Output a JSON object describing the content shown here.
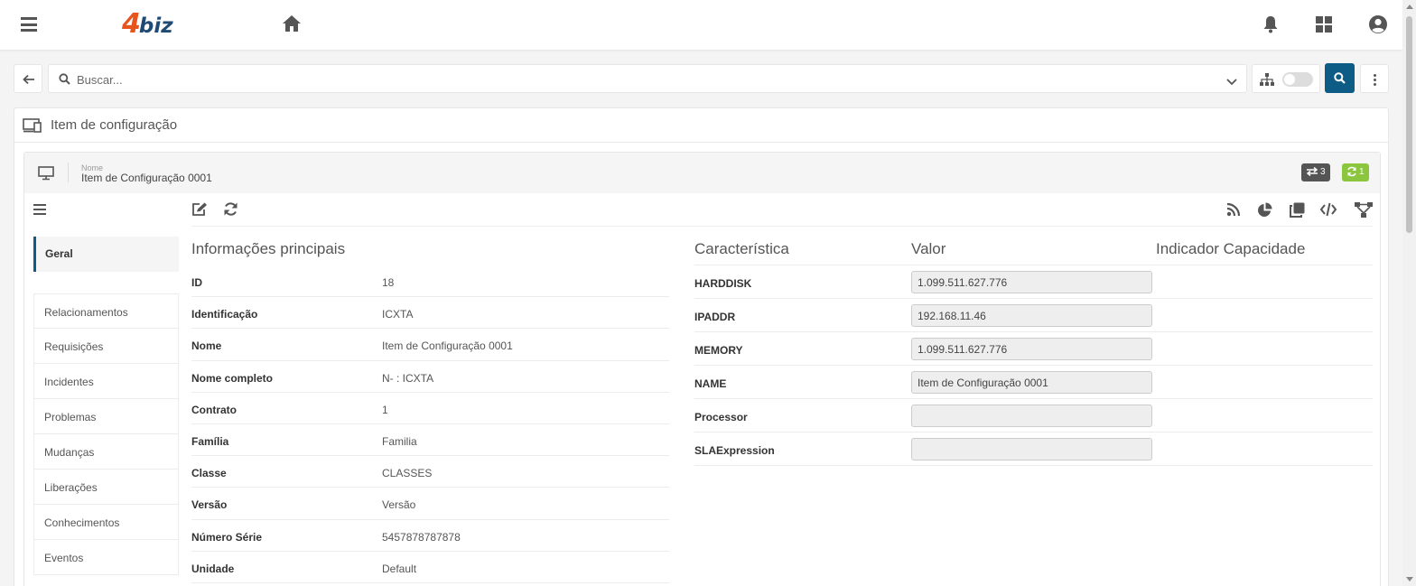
{
  "app": {
    "logo_number": "4",
    "logo_text": "biz"
  },
  "search": {
    "placeholder": "Buscar..."
  },
  "page": {
    "title": "Item de configuração"
  },
  "item": {
    "name_label": "Nome",
    "name": "Item de Configuração 0001",
    "badges": {
      "relationships_count": "3",
      "sync_count": "1"
    }
  },
  "sidebar": {
    "active": "Geral",
    "items": [
      "Relacionamentos",
      "Requisições",
      "Incidentes",
      "Problemas",
      "Mudanças",
      "Liberações",
      "Conhecimentos",
      "Eventos"
    ]
  },
  "info": {
    "title": "Informações principais",
    "rows": [
      {
        "label": "ID",
        "value": "18"
      },
      {
        "label": "Identificação",
        "value": "ICXTA"
      },
      {
        "label": "Nome",
        "value": "Item de Configuração 0001"
      },
      {
        "label": "Nome completo",
        "value": "N- : ICXTA"
      },
      {
        "label": "Contrato",
        "value": "1"
      },
      {
        "label": "Família",
        "value": "Familia"
      },
      {
        "label": "Classe",
        "value": "CLASSES"
      },
      {
        "label": "Versão",
        "value": "Versão"
      },
      {
        "label": "Número Série",
        "value": "5457878787878"
      },
      {
        "label": "Unidade",
        "value": "Default"
      }
    ]
  },
  "characteristics": {
    "headers": {
      "name": "Característica",
      "value": "Valor",
      "indicator": "Indicador Capacidade"
    },
    "rows": [
      {
        "label": "HARDDISK",
        "value": "1.099.511.627.776"
      },
      {
        "label": "IPADDR",
        "value": "192.168.11.46"
      },
      {
        "label": "MEMORY",
        "value": "1.099.511.627.776"
      },
      {
        "label": "NAME",
        "value": "Item de Configuração 0001"
      },
      {
        "label": "Processor",
        "value": ""
      },
      {
        "label": "SLAExpression",
        "value": ""
      }
    ]
  },
  "colors": {
    "accent": "#0d5c85",
    "logo_orange": "#e8541d",
    "logo_blue": "#1f4a73",
    "sync_green": "#8cc63f"
  },
  "icons": [
    "menu-icon",
    "home-icon",
    "bell-icon",
    "apps-icon",
    "user-icon",
    "arrow-left-icon",
    "search-icon",
    "chevron-down-icon",
    "sitemap-icon",
    "kebab-icon",
    "devices-icon",
    "monitor-icon",
    "exchange-icon",
    "sync-icon",
    "edit-icon",
    "refresh-icon",
    "rss-icon",
    "pie-chart-icon",
    "clone-icon",
    "code-icon",
    "network-icon"
  ]
}
